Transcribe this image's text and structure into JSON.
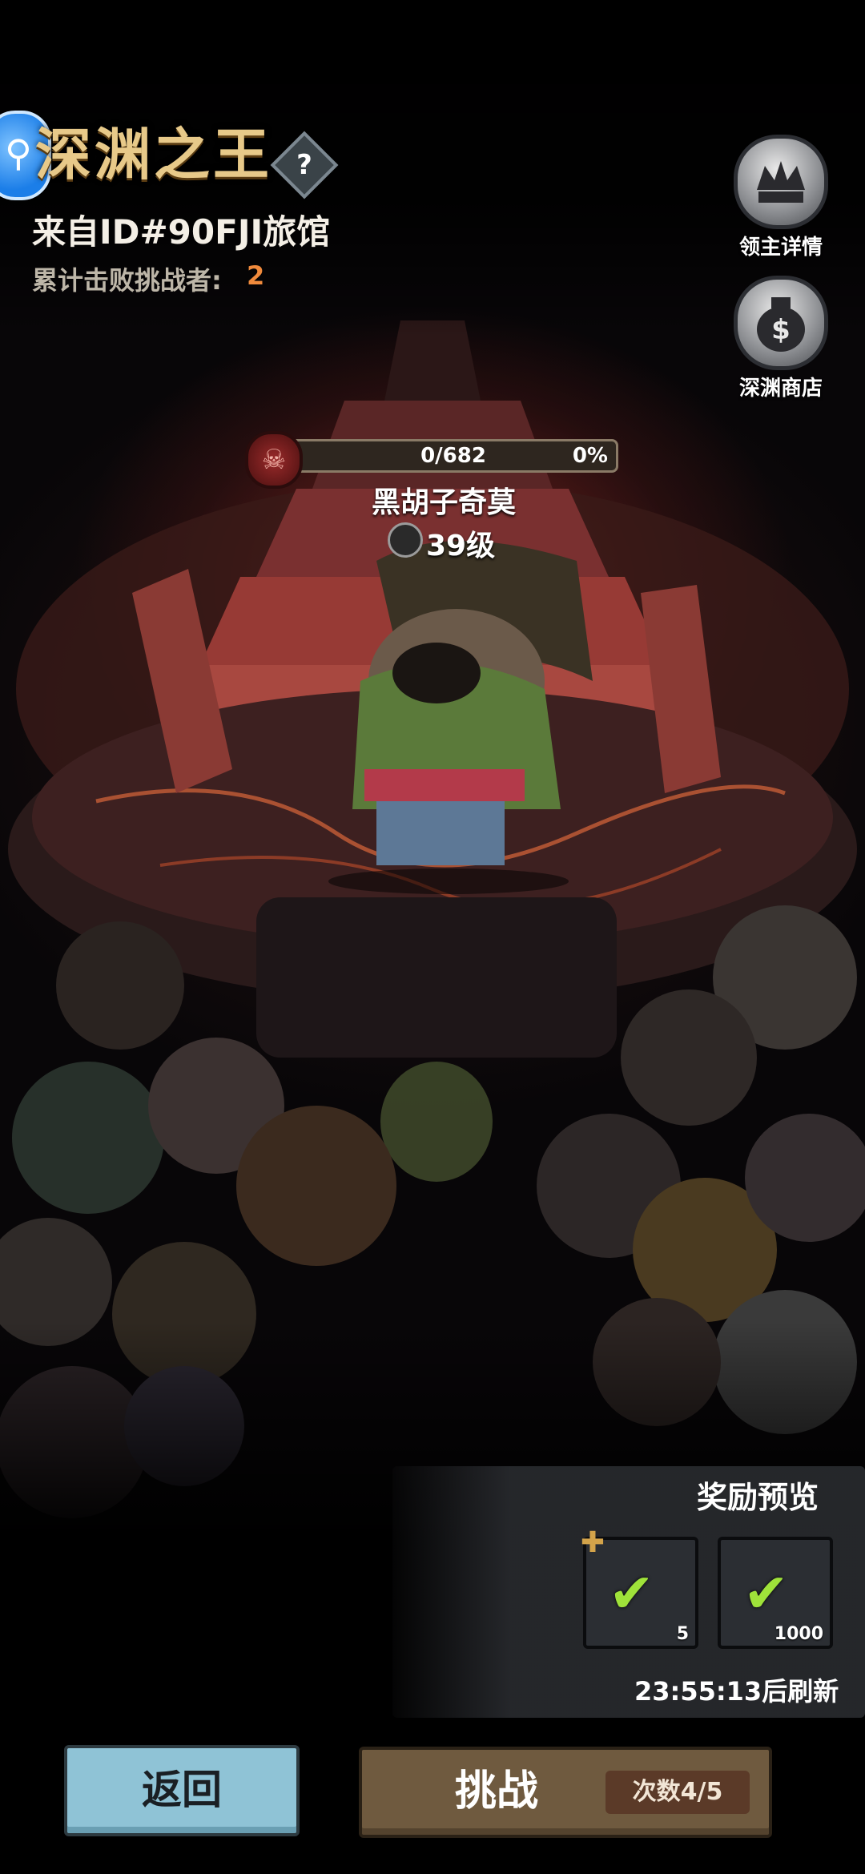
{
  "header": {
    "title": "深渊之王",
    "subtitle": "来自ID#90FJI旅馆",
    "defeated_label": "累计击败挑战者:",
    "defeated_count": "2"
  },
  "side_buttons": {
    "lord_details": "领主详情",
    "abyss_shop": "深渊商店"
  },
  "boss": {
    "hp_text": "0/682",
    "hp_percent_text": "0%",
    "hp_fraction": 0,
    "name": "黑胡子奇莫",
    "level": "39级"
  },
  "rewards": {
    "title": "奖励预览",
    "items": [
      {
        "qty": "5"
      },
      {
        "qty": "1000"
      }
    ],
    "refresh_text": "23:55:13后刷新"
  },
  "buttons": {
    "back": "返回",
    "challenge": "挑战",
    "attempts": "次数4/5"
  },
  "colors": {
    "title_gold": "#e7c989",
    "count_orange": "#f08a3c",
    "back_button": "#8fc3d6",
    "challenge_button": "#6f5a3f"
  }
}
